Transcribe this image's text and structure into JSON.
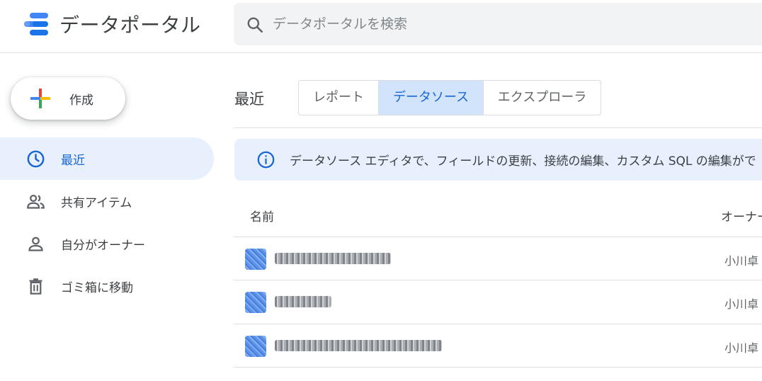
{
  "header": {
    "app_title": "データポータル",
    "search_placeholder": "データポータルを検索"
  },
  "sidebar": {
    "create_label": "作成",
    "items": [
      {
        "label": "最近",
        "icon": "clock-icon",
        "active": true
      },
      {
        "label": "共有アイテム",
        "icon": "people-icon",
        "active": false
      },
      {
        "label": "自分がオーナー",
        "icon": "person-icon",
        "active": false
      },
      {
        "label": "ゴミ箱に移動",
        "icon": "trash-icon",
        "active": false
      }
    ]
  },
  "main": {
    "section_title": "最近",
    "tabs": [
      {
        "label": "レポート",
        "selected": false
      },
      {
        "label": "データソース",
        "selected": true
      },
      {
        "label": "エクスプローラ",
        "selected": false
      }
    ],
    "info_banner": "データソース エディタで、フィールドの更新、接続の編集、カスタム SQL の編集がで",
    "columns": {
      "name": "名前",
      "owner": "オーナー"
    },
    "rows": [
      {
        "owner": "小川卓"
      },
      {
        "owner": "小川卓"
      },
      {
        "owner": "小川卓"
      }
    ]
  },
  "colors": {
    "accent": "#1967d2",
    "active_bg": "#e8f0fe",
    "tab_selected_bg": "#d2e3fc",
    "search_bg": "#f1f3f4"
  }
}
